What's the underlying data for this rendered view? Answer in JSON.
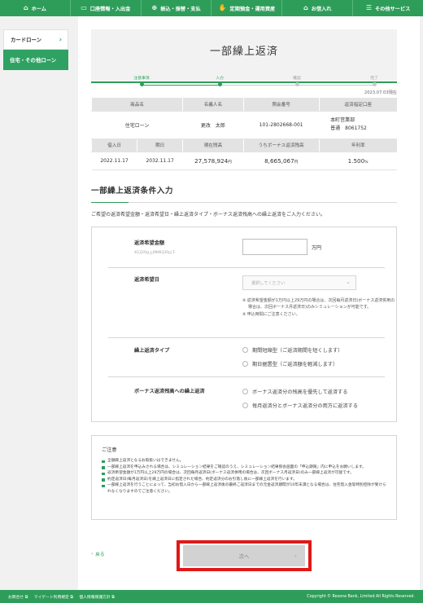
{
  "nav": [
    {
      "icon": "home-icon",
      "glyph": "⌂",
      "label": "ホーム"
    },
    {
      "icon": "account-icon",
      "glyph": "▭",
      "label": "口座情報・入出金"
    },
    {
      "icon": "transfer-icon",
      "glyph": "⊕",
      "label": "振込・振替・支払"
    },
    {
      "icon": "deposit-icon",
      "glyph": "✋",
      "label": "定期預金・運用資産"
    },
    {
      "icon": "loan-icon",
      "glyph": "⌂",
      "label": "お借入れ"
    },
    {
      "icon": "menu-icon",
      "glyph": "☰",
      "label": "その他サービス"
    }
  ],
  "sidebar": {
    "items": [
      {
        "label": "カードローン",
        "chevron": "›"
      },
      {
        "label": "住宅・その他ローン"
      }
    ]
  },
  "page": {
    "title": "一部繰上返済",
    "steps": [
      "注意事項",
      "入力",
      "確認",
      "完了"
    ],
    "current_step": 2,
    "as_of": "2023.07.03現在"
  },
  "loan_table": {
    "headers1": [
      "商品名",
      "名義人名",
      "照会番号",
      "返済指定口座"
    ],
    "product": "住宅ローン",
    "holder": "更改　太郎",
    "ref_no": "101-2802668-001",
    "branch": "本町営業部",
    "account": "普通　8061752",
    "headers2": [
      "借入日",
      "期日",
      "現在残高",
      "うちボーナス返済残高",
      "年利率"
    ],
    "loan_date": "2022.11.17",
    "due_date": "2032.11.17",
    "balance": "27,578,924",
    "bonus_balance": "8,665,067",
    "yen": "円",
    "rate": "1.500",
    "percent": "%"
  },
  "section": {
    "title": "一部繰上返済条件入力",
    "intro": "ご希望の返済希望金額・返済希望日・繰上返済タイプ・ボーナス返済残高への繰上返済をご入力ください。"
  },
  "form": {
    "amount_label": "返済希望金額",
    "amount_hint": "※1万円以上9999万円以下",
    "amount_value": "",
    "amount_unit": "万円",
    "date_label": "返済希望日",
    "date_placeholder": "選択してください",
    "date_caret": "⌄",
    "notes": [
      "※ 返済希望金額が1万円以上29万円の場合は、次回毎月返済日(ボーナス返済併用の場合は、次回ボーナス月返済日)のみシミュレーションが可能です。",
      "※ 申込時間にご注意ください。"
    ],
    "type_label": "繰上返済タイプ",
    "type_options": [
      "期間短縮型（ご返済期間を短くします）",
      "期日据置型（ご返済額を軽減します）"
    ],
    "bonus_label": "ボーナス返済残高への繰上返済",
    "bonus_options": [
      "ボーナス返済分の残高を優先して返済する",
      "毎月返済分とボーナス返済分の両方に返済する"
    ]
  },
  "caution": {
    "title": "ご注意",
    "items": [
      "全額繰上返済となるお取扱いはできません。",
      "一部繰上返済を申込みされる場合は、シミュレーション結果をご確認のうえ、シミュレーション結果照会画面の「申込期限」内に申込をお願いします。",
      "返済希望金額が1万円以上29万円の場合は、次回毎月返済日(ボーナス返済併用の場合は、次回ボーナス月返済日)のみ一部繰上返済が可能です。",
      "約定返済日(毎月返済日)を繰上返済日に指定された場合、約定返済分のお引落し後に一部繰上返済を行います。",
      "一部繰上返済を行うことによって、当初お借入日から一部繰上返済後の最終ご返済日までの元金返済期間が10年未満となる場合は、住宅借入金等特別控除が受けられなくなりますのでご注意ください。"
    ]
  },
  "actions": {
    "back": "戻る",
    "back_glyph": "‹",
    "next": "次へ",
    "next_glyph": "›"
  },
  "footer": {
    "links": [
      "お問合せ ⧉",
      "マイゲート利用規定 ⧉",
      "個人情報保護方針 ⧉"
    ],
    "copyright": "Copyright © Resona Bank, Limited All Rights Reserved."
  }
}
